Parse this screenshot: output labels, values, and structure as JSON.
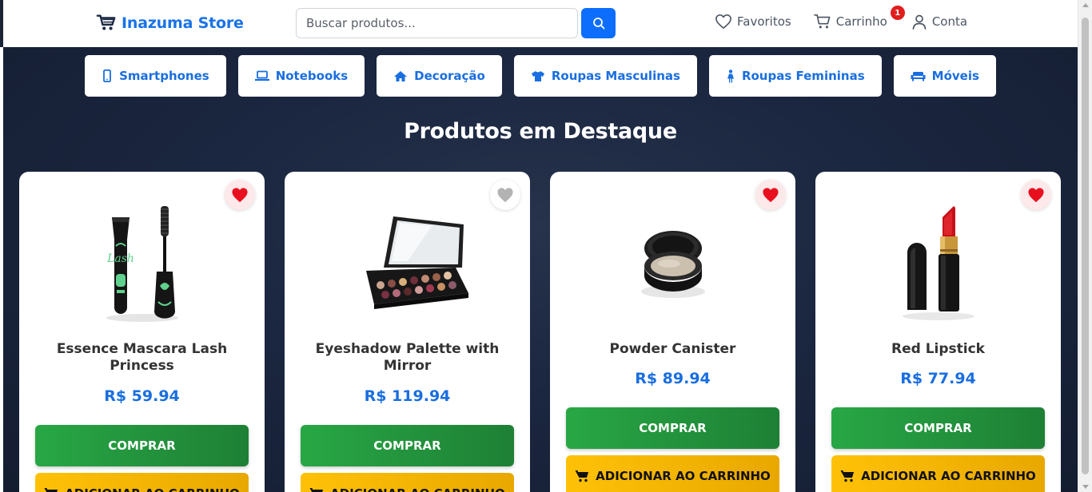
{
  "header": {
    "store_name": "Inazuma Store",
    "search_placeholder": "Buscar produtos...",
    "favorites_label": "Favoritos",
    "cart_label": "Carrinho",
    "cart_count": "1",
    "account_label": "Conta"
  },
  "categories": [
    {
      "label": "Smartphones",
      "icon": "smartphone-icon"
    },
    {
      "label": "Notebooks",
      "icon": "laptop-icon"
    },
    {
      "label": "Decoração",
      "icon": "home-icon"
    },
    {
      "label": "Roupas Masculinas",
      "icon": "tshirt-icon"
    },
    {
      "label": "Roupas Femininas",
      "icon": "female-icon"
    },
    {
      "label": "Móveis",
      "icon": "couch-icon"
    }
  ],
  "section_title": "Produtos em Destaque",
  "products": [
    {
      "name": "Essence Mascara Lash Princess",
      "price": "R$ 59.94",
      "favorited": true,
      "image": "mascara"
    },
    {
      "name": "Eyeshadow Palette with Mirror",
      "price": "R$ 119.94",
      "favorited": false,
      "image": "eyeshadow-palette"
    },
    {
      "name": "Powder Canister",
      "price": "R$ 89.94",
      "favorited": true,
      "image": "powder-canister"
    },
    {
      "name": "Red Lipstick",
      "price": "R$ 77.94",
      "favorited": true,
      "image": "red-lipstick"
    }
  ],
  "buttons": {
    "buy_label": "COMPRAR",
    "add_to_cart_label": "ADICIONAR AO CARRINHO"
  },
  "colors": {
    "brand_blue": "#1a73e8",
    "buy_green": "#28a745",
    "cart_yellow": "#ffc107",
    "heart_red": "#e8101f",
    "background_navy": "#1b2640"
  }
}
